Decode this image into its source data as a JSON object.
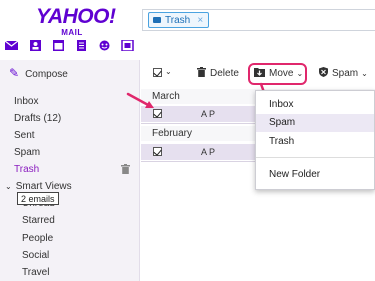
{
  "brand": {
    "logo_text": "YAHOO!",
    "logo_sub": "MAIL",
    "color": "#5f01d1"
  },
  "search": {
    "pill_label": "Trash",
    "pill_close": "×"
  },
  "app_icons": [
    "mail-icon",
    "contacts-icon",
    "calendar-icon",
    "notepad-icon",
    "messenger-icon",
    "newsfeed-icon"
  ],
  "compose": {
    "label": "Compose"
  },
  "sidebar": {
    "items": [
      {
        "label": "Inbox"
      },
      {
        "label": "Drafts (12)"
      },
      {
        "label": "Sent"
      },
      {
        "label": "Spam"
      },
      {
        "label": "Trash"
      }
    ],
    "smart_views": "Smart Views",
    "smart_items": [
      {
        "label": "Unread"
      },
      {
        "label": "Starred"
      },
      {
        "label": "People"
      },
      {
        "label": "Social"
      },
      {
        "label": "Travel"
      }
    ],
    "tooltip": "2 emails"
  },
  "toolbar": {
    "delete_label": "Delete",
    "move_label": "Move",
    "spam_label": "Spam"
  },
  "message_list": {
    "groups": [
      {
        "label": "March",
        "rows": [
          {
            "sender": "A P"
          }
        ]
      },
      {
        "label": "February",
        "rows": [
          {
            "sender": "A P"
          }
        ]
      }
    ]
  },
  "move_menu": {
    "items": [
      {
        "label": "Inbox"
      },
      {
        "label": "Spam"
      },
      {
        "label": "Trash"
      },
      {
        "label": "New Folder"
      }
    ]
  },
  "colors": {
    "accent": "#5f01d1",
    "highlight": "#e0276c",
    "selected_row": "#e6e0ef"
  }
}
